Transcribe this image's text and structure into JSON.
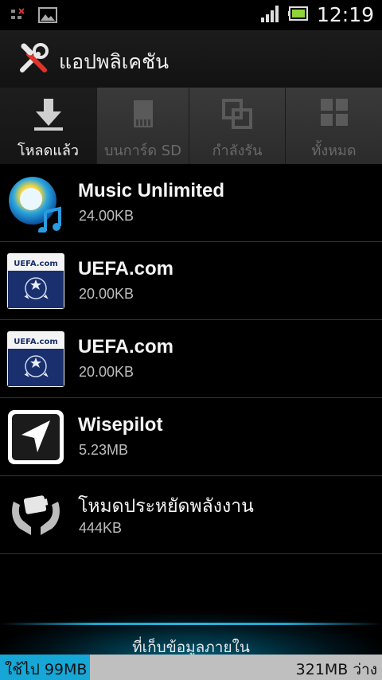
{
  "status_bar": {
    "time": "12:19",
    "icons": [
      "notification-icon",
      "image-icon",
      "signal-icon",
      "battery-icon"
    ]
  },
  "action_bar": {
    "title": "แอปพลิเคชัน",
    "icon": "tools-icon"
  },
  "tabs": [
    {
      "label": "โหลดแล้ว",
      "icon": "download-icon",
      "active": true
    },
    {
      "label": "บนการ์ด SD",
      "icon": "sd-card-icon",
      "active": false
    },
    {
      "label": "กำลังรัน",
      "icon": "running-icon",
      "active": false
    },
    {
      "label": "ทั้งหมด",
      "icon": "grid-icon",
      "active": false
    }
  ],
  "apps": [
    {
      "name": "Music Unlimited",
      "size": "24.00KB",
      "icon": "music-unlimited-icon"
    },
    {
      "name": "UEFA.com",
      "size": "20.00KB",
      "icon": "uefa-icon",
      "icon_text": "UEFA.com"
    },
    {
      "name": "UEFA.com",
      "size": "20.00KB",
      "icon": "uefa-icon",
      "icon_text": "UEFA.com"
    },
    {
      "name": "Wisepilot",
      "size": "5.23MB",
      "icon": "wisepilot-icon"
    },
    {
      "name": "โหมดประหยัดพลังงาน",
      "size": "444KB",
      "icon": "power-saver-icon"
    }
  ],
  "storage": {
    "label": "ที่เก็บข้อมูลภายใน",
    "used": "ใช้ไป 99MB",
    "free": "321MB ว่าง",
    "used_fraction": 0.236,
    "accent_color": "#16a7d7"
  }
}
